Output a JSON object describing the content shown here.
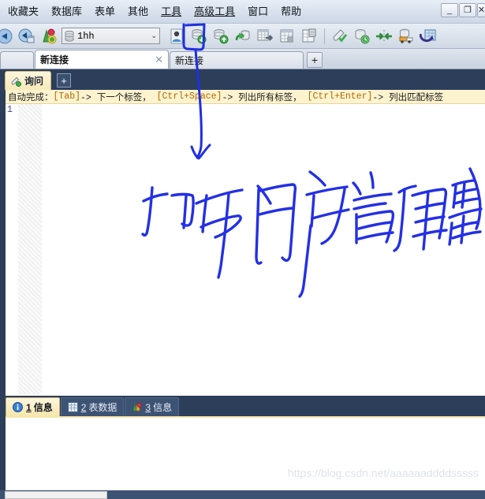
{
  "window": {
    "controls": [
      {
        "name": "minimize",
        "glyph": "_"
      },
      {
        "name": "restore",
        "glyph": "❐"
      },
      {
        "name": "close",
        "glyph": "✕"
      }
    ]
  },
  "menubar": {
    "items": [
      {
        "label": "收藏夹",
        "underlined": false
      },
      {
        "label": "数据库",
        "underlined": false
      },
      {
        "label": "表单",
        "underlined": false
      },
      {
        "label": "其他",
        "underlined": false
      },
      {
        "label": "工具",
        "underlined": true
      },
      {
        "label": "高级工具",
        "underlined": true
      },
      {
        "label": "窗口",
        "underlined": false
      },
      {
        "label": "帮助",
        "underlined": false
      }
    ]
  },
  "toolbar": {
    "database_selector": {
      "value": "1hh",
      "placeholder": "1hh",
      "icon": "database-icon",
      "caret": "⌄"
    },
    "icons": [
      {
        "name": "back-navigate-icon"
      },
      {
        "name": "connection-window-icon"
      },
      {
        "name": "new-connection-icon"
      },
      {
        "name": "user-manager-icon",
        "highlighted": true
      },
      {
        "name": "open-database-icon"
      },
      {
        "name": "close-database-icon"
      },
      {
        "name": "refresh-database-icon"
      },
      {
        "name": "export-table-icon"
      },
      {
        "name": "table-grid-icon"
      },
      {
        "name": "table-design-icon"
      },
      {
        "name": "backup-icon"
      },
      {
        "name": "schedule-database-icon"
      },
      {
        "name": "data-transfer-icon"
      },
      {
        "name": "data-import-icon"
      },
      {
        "name": "data-sync-icon"
      }
    ]
  },
  "connection_tabs": {
    "tabs": [
      {
        "label": "",
        "active": false,
        "closable": false
      },
      {
        "label": "新连接",
        "active": true,
        "closable": true,
        "close_glyph": "✕"
      },
      {
        "label": "新连接",
        "active": false,
        "closable": false
      }
    ],
    "add_button": "+"
  },
  "query_header": {
    "tab_label": "询问",
    "tab_icon": "query-icon",
    "add_button": "+"
  },
  "editor": {
    "autocomplete_hint": {
      "prefix": "自动完成：",
      "segments": [
        {
          "key": "[Tab]",
          "text": "-> 下一个标签，"
        },
        {
          "key": "[Ctrl+Space]",
          "text": "-> 列出所有标签，"
        },
        {
          "key": "[Ctrl+Enter]",
          "text": "-> 列出匹配标签"
        }
      ],
      "full": "自动完成： [Tab]-> 下一个标签， [Ctrl+Space]-> 列出所有标签， [Ctrl+Enter]-> 列出匹配标签"
    },
    "line_numbers": [
      "1"
    ],
    "sql": ""
  },
  "result_tabs": [
    {
      "num": "1",
      "label": "信息",
      "icon": "info-icon",
      "active": true
    },
    {
      "num": "2",
      "label": "表数据",
      "icon": "table-data-icon",
      "active": false
    },
    {
      "num": "3",
      "label": "信息",
      "icon": "profile-info-icon",
      "active": false
    }
  ],
  "result_panel": {
    "content": "",
    "watermark": "https://blog.csdn.net/aaaaaaddddsssss"
  },
  "annotation": {
    "handwriting_text": "打开用户管理器",
    "color": "#1f2fe0",
    "description": "hand-drawn blue box around user-manager toolbar icon with arrow pointing down to handwritten note"
  },
  "colors": {
    "navy": "#2c3e5a",
    "tab_yellow": "#f6e6ad",
    "hint_yellow": "#fdf3cf",
    "annotation_blue": "#1f2fe0",
    "toolbar_gray": "#dce3ec"
  }
}
